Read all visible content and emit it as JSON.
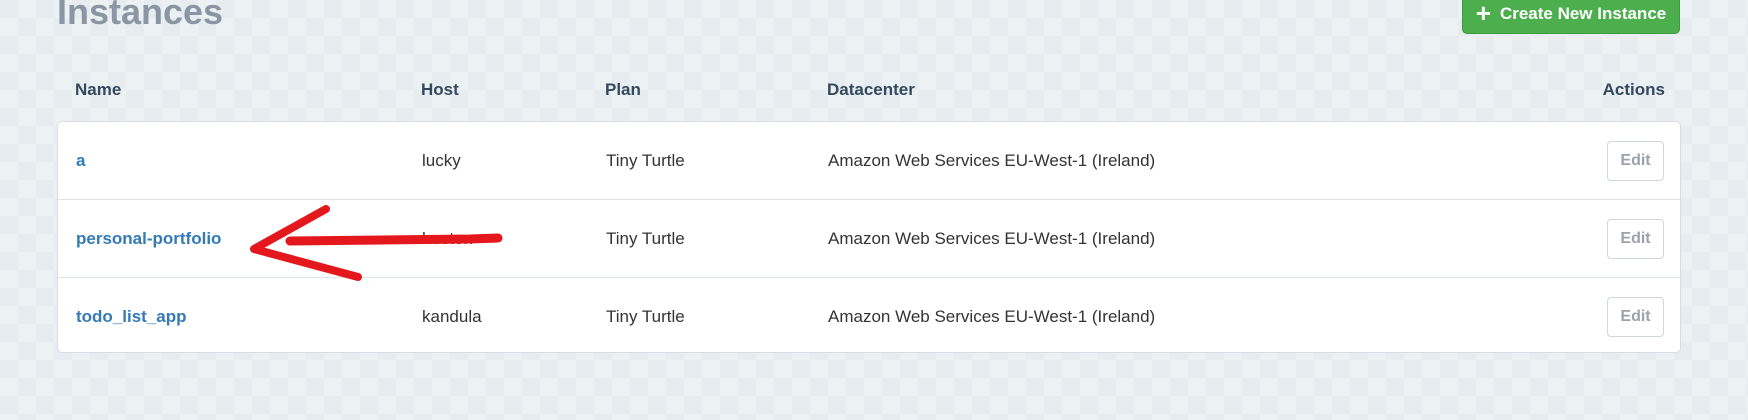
{
  "page": {
    "title": "Instances",
    "create_button_label": "Create New Instance"
  },
  "table": {
    "headers": {
      "name": "Name",
      "host": "Host",
      "plan": "Plan",
      "datacenter": "Datacenter",
      "actions": "Actions"
    },
    "rows": [
      {
        "name": "a",
        "host": "lucky",
        "plan": "Tiny Turtle",
        "datacenter": "Amazon Web Services EU-West-1 (Ireland)",
        "action": "Edit"
      },
      {
        "name": "personal-portfolio",
        "host": "hosten",
        "plan": "Tiny Turtle",
        "datacenter": "Amazon Web Services EU-West-1 (Ireland)",
        "action": "Edit"
      },
      {
        "name": "todo_list_app",
        "host": "kandula",
        "plan": "Tiny Turtle",
        "datacenter": "Amazon Web Services EU-West-1 (Ireland)",
        "action": "Edit"
      }
    ]
  },
  "colors": {
    "primary_button": "#4cae4c",
    "link": "#337ab7",
    "annotation": "#e3171c"
  },
  "icons": {
    "create": "plus-icon"
  }
}
